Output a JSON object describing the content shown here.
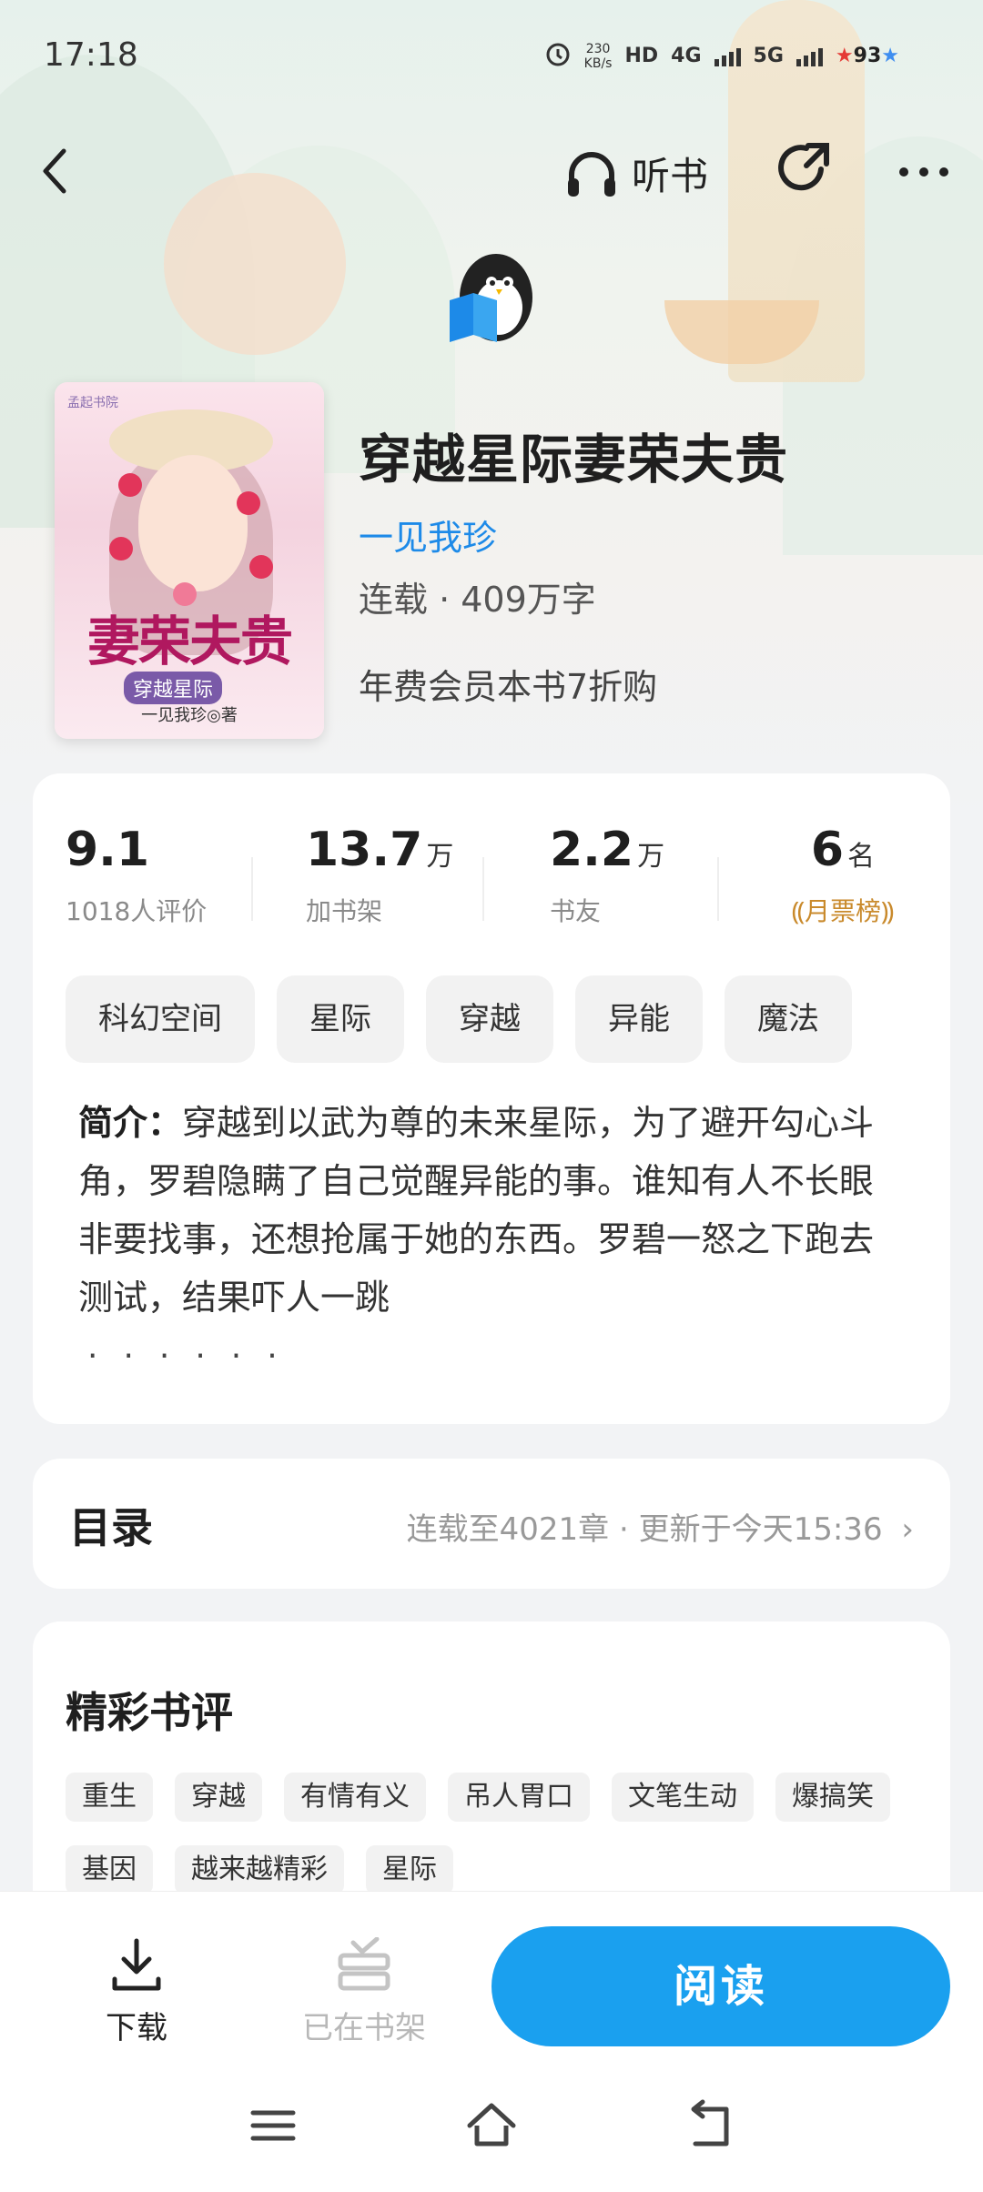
{
  "status_bar": {
    "time": "17:18",
    "net_speed_value": "230",
    "net_speed_unit": "KB/s",
    "hd_label": "HD",
    "network_4g": "4G",
    "network_5g": "5G",
    "battery": "93"
  },
  "nav": {
    "listen_label": "听书"
  },
  "book": {
    "title": "穿越星际妻荣夫贵",
    "author": "一见我珍",
    "meta": "连载 · 409万字",
    "promo": "年费会员本书7折购",
    "cover": {
      "publisher": "孟起书院",
      "title": "妻荣夫贵",
      "subtitle": "穿越星际",
      "author_line": "一见我珍◎著"
    }
  },
  "stats": [
    {
      "value": "9.1",
      "unit": "",
      "label": "1018人评价"
    },
    {
      "value": "13.7",
      "unit": "万",
      "label": "加书架"
    },
    {
      "value": "2.2",
      "unit": "万",
      "label": "书友"
    },
    {
      "value": "6",
      "unit": "名",
      "label": "月票榜"
    }
  ],
  "tags": [
    "科幻空间",
    "星际",
    "穿越",
    "异能",
    "魔法"
  ],
  "intro": {
    "label": "简介：",
    "text": "穿越到以武为尊的未来星际，为了避开勾心斗角，罗碧隐瞒了自己觉醒异能的事。谁知有人不长眼非要找事，还想抢属于她的东西。罗碧一怒之下跑去测试，结果吓人一跳",
    "ellipsis": "······"
  },
  "toc": {
    "title": "目录",
    "info": "连载至4021章 · 更新于今天15:36",
    "chevron": "›"
  },
  "reviews": {
    "title": "精彩书评",
    "tags": [
      "重生",
      "穿越",
      "有情有义",
      "吊人胃口",
      "文笔生动",
      "爆搞笑",
      "基因",
      "越来越精彩",
      "星际"
    ]
  },
  "bottom_bar": {
    "download_label": "下载",
    "shelf_label": "已在书架",
    "read_label": "阅读"
  },
  "colors": {
    "accent": "#1aa0ef",
    "author": "#1d8ae8",
    "rank": "#c98a2c"
  }
}
